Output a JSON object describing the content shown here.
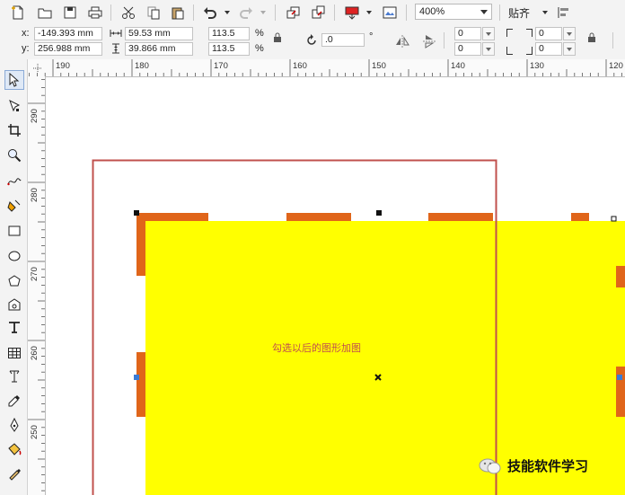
{
  "toolbar": {
    "zoom_value": "400%",
    "snap_label": "贴齐"
  },
  "properties": {
    "x_label": "x:",
    "y_label": "y:",
    "x_value": "-149.393 mm",
    "y_value": "256.988 mm",
    "width_value": "59.53 mm",
    "height_value": "39.866 mm",
    "scale_x": "113.5",
    "scale_y": "113.5",
    "percent_1": "%",
    "percent_2": "%",
    "angle_value": ".0",
    "degree_symbol": "°",
    "outline_a": "0",
    "outline_b": "0",
    "outline_c": "0",
    "outline_d": "0"
  },
  "rulers": {
    "h_ticks": [
      "190",
      "180",
      "170",
      "160",
      "150",
      "140",
      "130",
      "120"
    ],
    "v_ticks": [
      "290",
      "280",
      "270",
      "260",
      "250"
    ]
  },
  "canvas": {
    "annotation": "勾选以后的图形加图",
    "watermark": "技能软件学习"
  },
  "colors": {
    "yellow_fill": "#ffff00",
    "orange_dash": "#e0651a",
    "red_frame": "#c0504d"
  },
  "icons": [
    "new-icon",
    "open-icon",
    "save-icon",
    "print-icon",
    "cut-icon",
    "copy-icon",
    "paste-icon",
    "undo-icon",
    "redo-icon",
    "import-icon",
    "export-icon",
    "publish-icon",
    "fullscreen-icon",
    "snap-menu-icon",
    "align-icon",
    "lock-icon",
    "rotate-icon",
    "mirror-h-icon",
    "mirror-v-icon",
    "pick-tool-icon",
    "shape-tool-icon",
    "crop-tool-icon",
    "zoom-tool-icon",
    "freehand-tool-icon",
    "smart-fill-icon",
    "rectangle-tool-icon",
    "ellipse-tool-icon",
    "polygon-tool-icon",
    "basic-shapes-icon",
    "text-tool-icon",
    "table-tool-icon",
    "parallel-dimension-icon",
    "eyedropper-icon",
    "outline-pen-icon",
    "fill-tool-icon",
    "interactive-fill-icon"
  ]
}
